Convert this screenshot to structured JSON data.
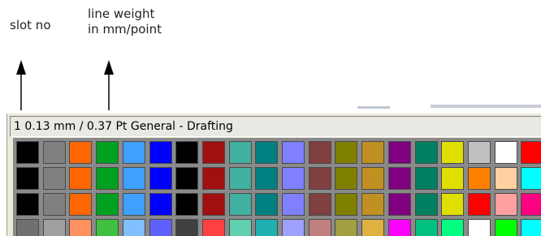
{
  "annotations": {
    "slot_label": "slot no",
    "weight_label_line1": "line weight",
    "weight_label_line2": "in mm/point"
  },
  "status_bar": {
    "text": "1  0.13 mm /  0.37 Pt General - Drafting"
  },
  "palette": {
    "rows": [
      [
        "#000000",
        "#808080",
        "#ff6600",
        "#00a020",
        "#40a0ff",
        "#0000ff",
        "#000000",
        "#a01010",
        "#40b0a0",
        "#008080",
        "#8080ff",
        "#804040",
        "#808000",
        "#c09020",
        "#800080",
        "#008060",
        "#e0e000",
        "#c0c0c0",
        "#ffffff",
        "#ff0000"
      ],
      [
        "#000000",
        "#808080",
        "#ff6600",
        "#00a020",
        "#40a0ff",
        "#0000ff",
        "#000000",
        "#a01010",
        "#40b0a0",
        "#008080",
        "#8080ff",
        "#804040",
        "#808000",
        "#c09020",
        "#800080",
        "#008060",
        "#e0e000",
        "#ff8000",
        "#ffd0a0",
        "#00ffff"
      ],
      [
        "#000000",
        "#808080",
        "#ff6600",
        "#00a020",
        "#40a0ff",
        "#0000ff",
        "#000000",
        "#a01010",
        "#40b0a0",
        "#008080",
        "#8080ff",
        "#804040",
        "#808000",
        "#c09020",
        "#800080",
        "#008060",
        "#e0e000",
        "#ff0000",
        "#ffa0a0",
        "#ff0080"
      ],
      [
        "#707070",
        "#a0a0a0",
        "#ff9060",
        "#40c040",
        "#80c0ff",
        "#6060ff",
        "#404040",
        "#ff4040",
        "#60d0b0",
        "#20b0b0",
        "#a0a0ff",
        "#c08080",
        "#a0a040",
        "#e0b040",
        "#ff00ff",
        "#00c080",
        "#00ff80",
        "#ffffff",
        "#00ff00",
        "#00ffff"
      ]
    ],
    "selected_slot": 1
  }
}
